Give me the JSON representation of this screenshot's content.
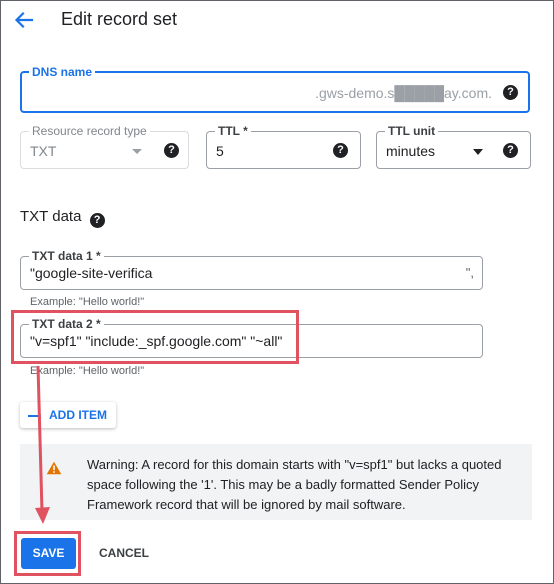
{
  "header": {
    "title": "Edit record set",
    "back_icon": "arrow-back-icon"
  },
  "dns": {
    "label": "DNS name",
    "value": "",
    "suffix": ".gws-demo.s█████ay.com."
  },
  "rrtype": {
    "label": "Resource record type",
    "value": "TXT"
  },
  "ttl": {
    "label": "TTL *",
    "value": "5"
  },
  "ttl_unit": {
    "label": "TTL unit",
    "value": "minutes"
  },
  "txt_section": {
    "title": "TXT data"
  },
  "txt1": {
    "label": "TXT data 1 *",
    "value": "\"google-site-verifica",
    "trailing": "\",",
    "hint": "Example: \"Hello world!\""
  },
  "txt2": {
    "label": "TXT data 2 *",
    "value": "\"v=spf1\" \"include:_spf.google.com\" \"~all\"",
    "hint": "Example: \"Hello world!\""
  },
  "add_item": {
    "label": "ADD ITEM"
  },
  "warning": {
    "text": "Warning: A record for this domain starts with \"v=spf1\" but lacks a quoted space following the '1'. This may be a badly formatted Sender Policy Framework record that will be ignored by mail software."
  },
  "actions": {
    "save": "SAVE",
    "cancel": "CANCEL"
  },
  "colors": {
    "accent": "#1a73e8",
    "callout": "#e05260",
    "warning": "#e37400"
  }
}
